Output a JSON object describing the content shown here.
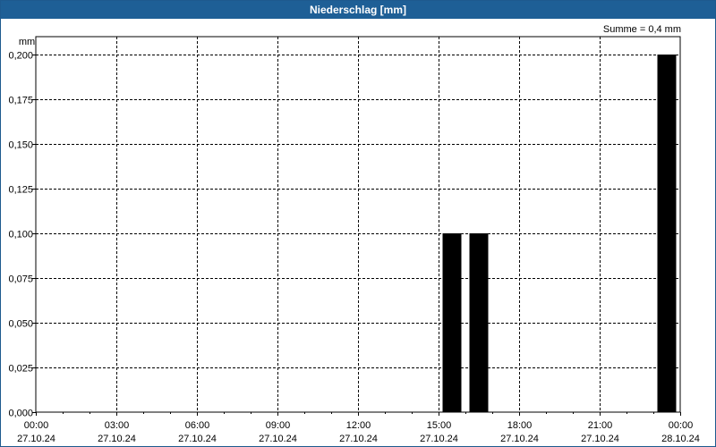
{
  "window": {
    "title": "Niederschlag [mm]"
  },
  "summary": "Summe = 0,4 mm",
  "y_unit": "mm",
  "chart_data": {
    "type": "bar",
    "title": "Niederschlag [mm]",
    "ylabel": "mm",
    "xlabel": "",
    "ylim": [
      0,
      0.2
    ],
    "xlim": [
      "2024-10-27T00:00",
      "2024-10-28T00:00"
    ],
    "grid": true,
    "y_ticks": [
      "0,000",
      "0,025",
      "0,050",
      "0,075",
      "0,100",
      "0,125",
      "0,150",
      "0,175",
      "0,200"
    ],
    "x_ticks": [
      {
        "time": "00:00",
        "date": "27.10.24"
      },
      {
        "time": "03:00",
        "date": "27.10.24"
      },
      {
        "time": "06:00",
        "date": "27.10.24"
      },
      {
        "time": "09:00",
        "date": "27.10.24"
      },
      {
        "time": "12:00",
        "date": "27.10.24"
      },
      {
        "time": "15:00",
        "date": "27.10.24"
      },
      {
        "time": "18:00",
        "date": "27.10.24"
      },
      {
        "time": "21:00",
        "date": "27.10.24"
      },
      {
        "time": "00:00",
        "date": "28.10.24"
      }
    ],
    "bars": [
      {
        "start": "2024-10-27T15:00",
        "end": "2024-10-27T16:00",
        "value": 0.1
      },
      {
        "start": "2024-10-27T16:00",
        "end": "2024-10-27T17:00",
        "value": 0.1
      },
      {
        "start": "2024-10-27T23:00",
        "end": "2024-10-28T00:00",
        "value": 0.2
      }
    ],
    "bar_color": "#000000"
  }
}
